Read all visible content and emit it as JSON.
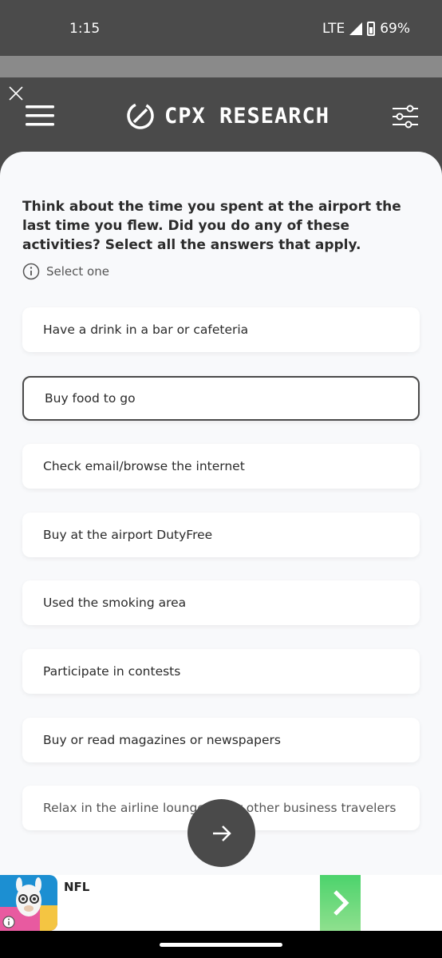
{
  "status_bar": {
    "time": "1:15",
    "network": "LTE",
    "battery": "69%"
  },
  "header": {
    "brand": "CPX RESEARCH"
  },
  "survey": {
    "question": "Think about the time you spent at the airport the last time you flew. Did you do any of these activities? Select all the answers that apply.",
    "hint": "Select one",
    "options": [
      {
        "label": "Have a drink in a bar or cafeteria"
      },
      {
        "label": "Buy food to go"
      },
      {
        "label": "Check email/browse the internet"
      },
      {
        "label": "Buy at the airport DutyFree"
      },
      {
        "label": "Used the smoking area"
      },
      {
        "label": "Participate in contests"
      },
      {
        "label": "Buy or read magazines or newspapers"
      },
      {
        "label": "Relax in the airline lounge or for other business travelers"
      }
    ],
    "selected_index": 1
  },
  "ad": {
    "title": "NFL"
  },
  "colors": {
    "header_bg": "#4a4a4a",
    "content_bg": "#f8f9fb",
    "ad_button": "#4cd36c"
  },
  "icons": [
    "close-icon",
    "menu-icon",
    "logo-icon",
    "filter-icon",
    "info-icon",
    "arrow-right-icon",
    "chevron-right-icon"
  ]
}
